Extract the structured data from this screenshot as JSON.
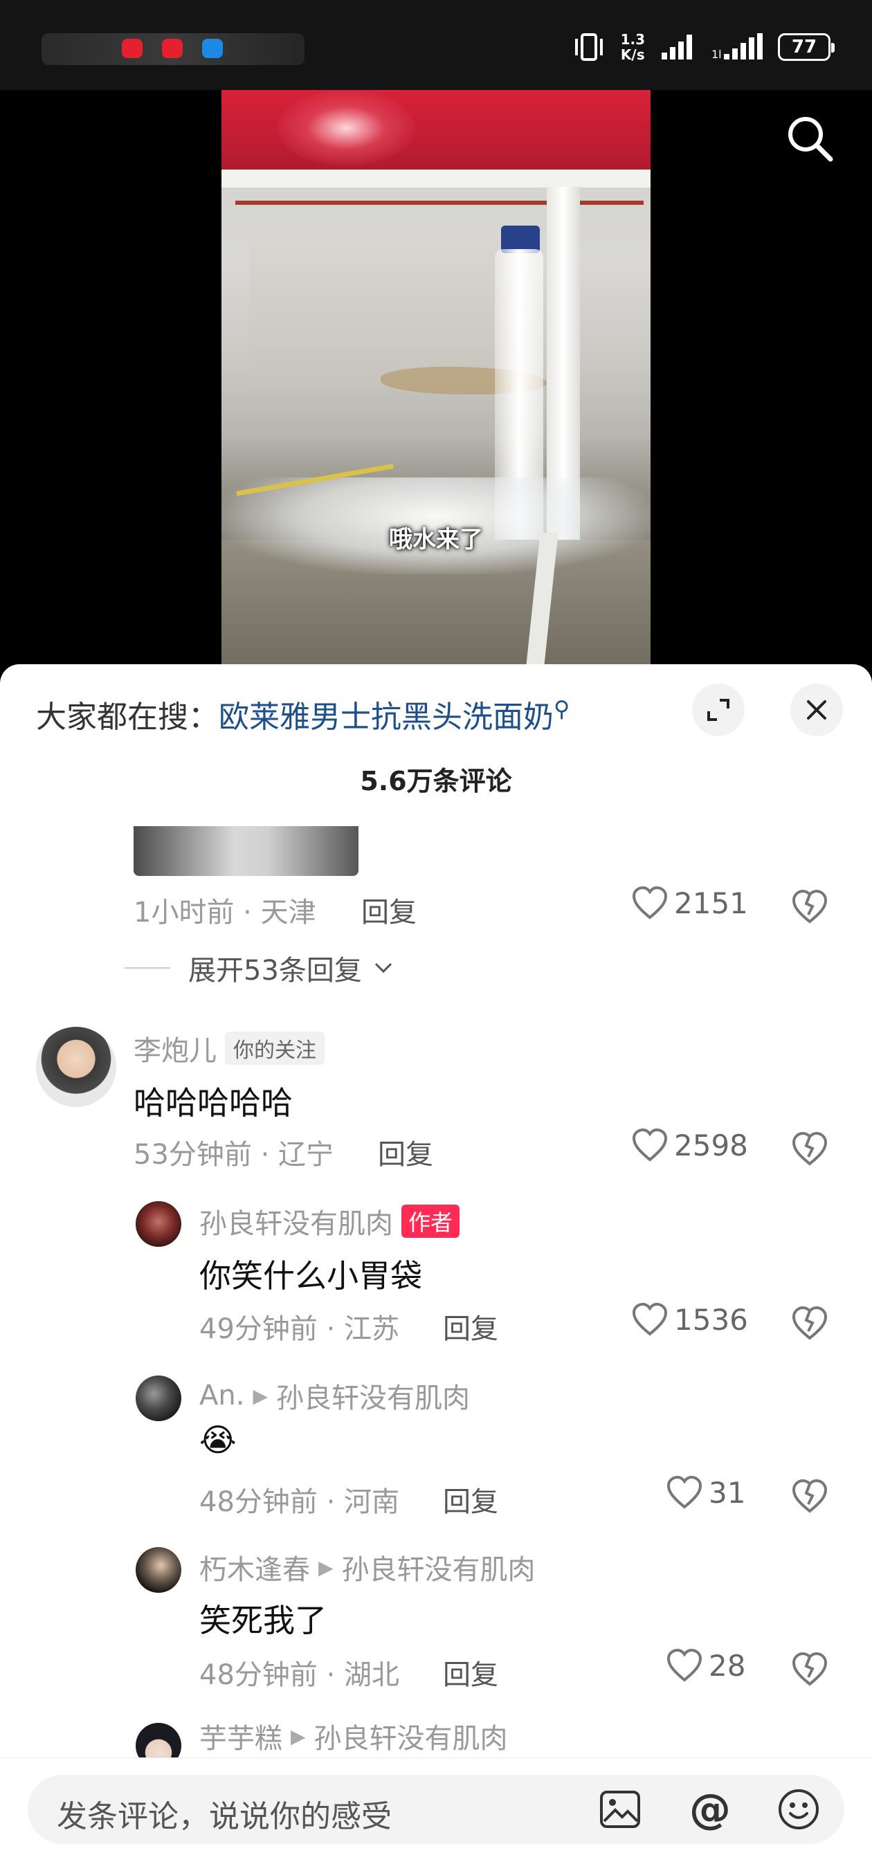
{
  "status_bar": {
    "net_speed_value": "1.3",
    "net_speed_unit": "K/s",
    "battery": "77",
    "notification_colors": [
      "#e5202f",
      "#e5202f",
      "#1e88e5"
    ]
  },
  "video": {
    "subtitle": "哦水来了"
  },
  "comments_panel": {
    "hot_search_label": "大家都在搜：",
    "hot_search_query": "欧莱雅男士抗黑头洗面奶",
    "comment_count_title": "5.6万条评论",
    "previous": {
      "time_location": "1小时前 · 天津",
      "reply_label": "回复",
      "likes": "2151",
      "expand_label": "展开53条回复"
    },
    "comments": [
      {
        "user": "李炮儿",
        "tag": "你的关注",
        "text": "哈哈哈哈哈",
        "time_location": "53分钟前 · 辽宁",
        "reply_label": "回复",
        "likes": "2598"
      },
      {
        "user": "孙良轩没有肌肉",
        "tag": "作者",
        "text": "你笑什么小胃袋",
        "time_location": "49分钟前 · 江苏",
        "reply_label": "回复",
        "likes": "1536"
      },
      {
        "user": "An.",
        "reply_to": "孙良轩没有肌肉",
        "text": "😭",
        "time_location": "48分钟前 · 河南",
        "reply_label": "回复",
        "likes": "31"
      },
      {
        "user": "朽木逢春",
        "reply_to": "孙良轩没有肌肉",
        "text": "笑死我了",
        "time_location": "48分钟前 · 湖北",
        "reply_label": "回复",
        "likes": "28"
      },
      {
        "user": "芋芋糕",
        "reply_to": "孙良轩没有肌肉"
      }
    ]
  },
  "input_bar": {
    "placeholder": "发条评论，说说你的感受"
  },
  "colors": {
    "accent_link": "#1d4f8c",
    "author_tag": "#fe2c55"
  }
}
